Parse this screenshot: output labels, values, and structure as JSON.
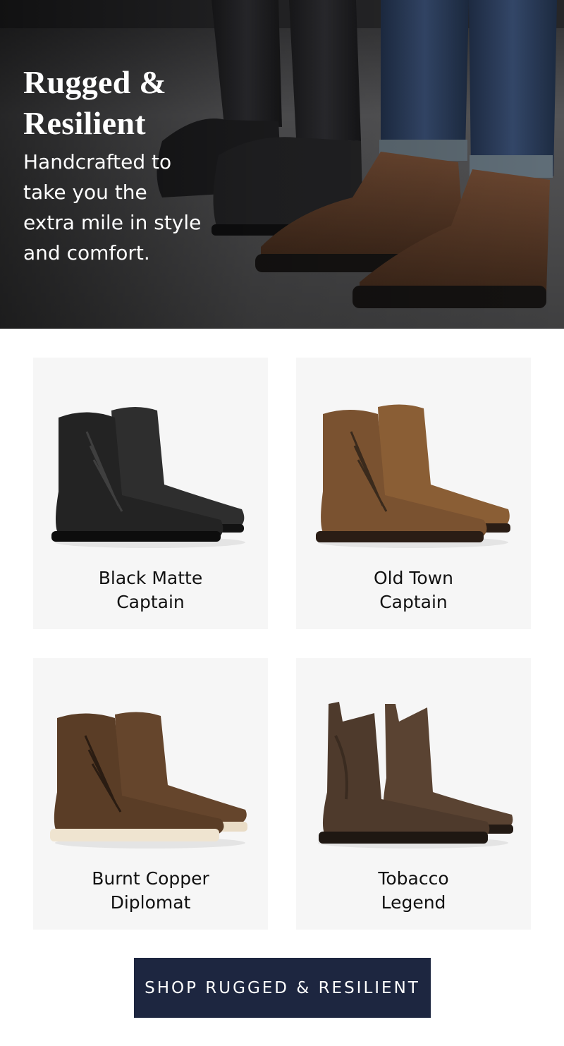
{
  "hero": {
    "title": "Rugged &\nResilient",
    "subtitle": "Handcrafted to\ntake you the\nextra mile in style\nand comfort."
  },
  "products": [
    {
      "name": "Black Matte\nCaptain",
      "color": "#232323"
    },
    {
      "name": "Old Town\nCaptain",
      "color": "#7a5230"
    },
    {
      "name": "Burnt Copper\nDiplomat",
      "color": "#5a3d26"
    },
    {
      "name": "Tobacco\nLegend",
      "color": "#4e3a2c"
    }
  ],
  "cta": {
    "label": "SHOP RUGGED & RESILIENT"
  },
  "colors": {
    "cta_bg": "#1d2640",
    "card_bg": "#f6f6f6"
  }
}
